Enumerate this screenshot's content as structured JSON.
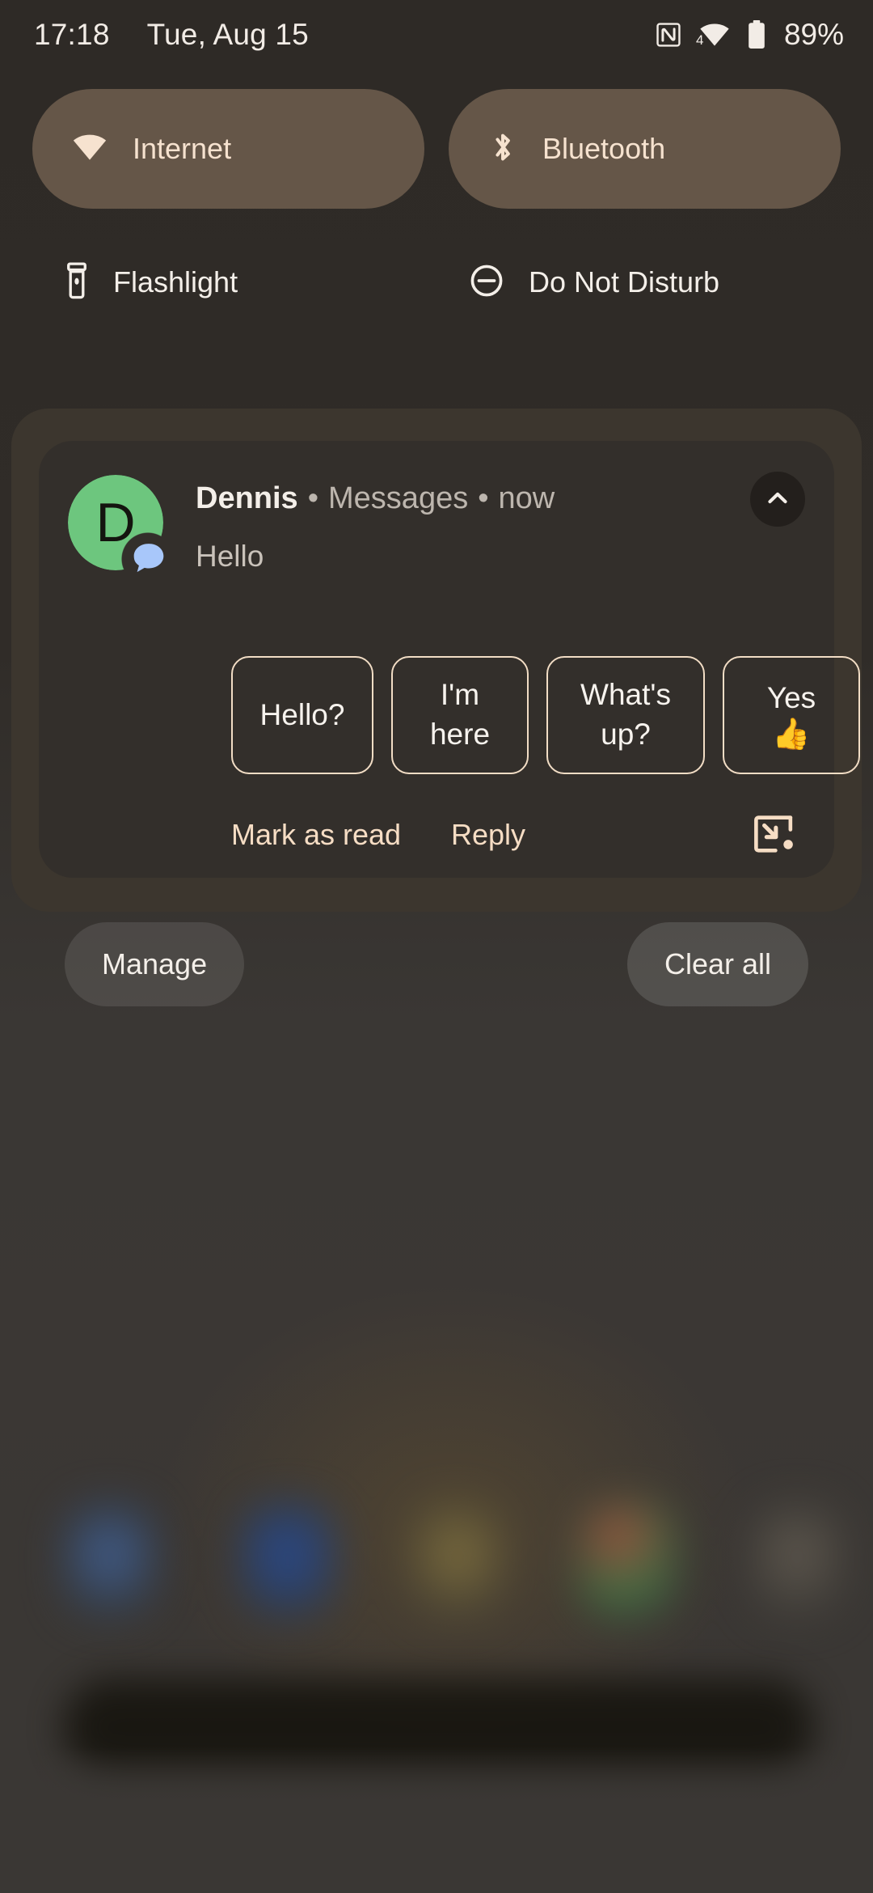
{
  "status_bar": {
    "clock": "17:18",
    "date": "Tue, Aug 15",
    "nfc_icon": "nfc-icon",
    "wifi_icon": "wifi-icon",
    "wifi_badge": "4",
    "battery_icon": "battery-icon",
    "battery_level": "89%"
  },
  "quick_settings": {
    "row1": [
      {
        "label": "Internet",
        "icon": "wifi-icon",
        "active": true
      },
      {
        "label": "Bluetooth",
        "icon": "bluetooth-icon",
        "active": true
      }
    ],
    "row2": [
      {
        "label": "Flashlight",
        "icon": "flashlight-icon",
        "active": false
      },
      {
        "label": "Do Not Disturb",
        "icon": "do-not-disturb-icon",
        "active": false
      }
    ]
  },
  "notification": {
    "avatar_letter": "D",
    "avatar_color": "#6dc67e",
    "badge_icon": "chat-bubble-icon",
    "badge_color": "#a8c7fa",
    "sender": "Dennis",
    "separator": "•",
    "app": "Messages",
    "time": "now",
    "message": "Hello",
    "collapse_icon": "chevron-up-icon",
    "smart_replies": [
      {
        "text": "Hello?",
        "emoji": ""
      },
      {
        "text": "I'm here",
        "emoji": ""
      },
      {
        "text": "What's up?",
        "emoji": ""
      },
      {
        "text": "Yes",
        "emoji": "👍"
      }
    ],
    "actions": [
      {
        "label": "Mark as read"
      },
      {
        "label": "Reply"
      }
    ],
    "bubble_icon": "bubble-icon"
  },
  "footer": {
    "manage_label": "Manage",
    "clear_all_label": "Clear all"
  },
  "colors": {
    "tile_active_bg": "#655648",
    "tile_text": "#f6e2cf",
    "accent_text": "#f6ddc4",
    "shade_bg": "#3c362e",
    "card_bg": "#332f2b"
  }
}
